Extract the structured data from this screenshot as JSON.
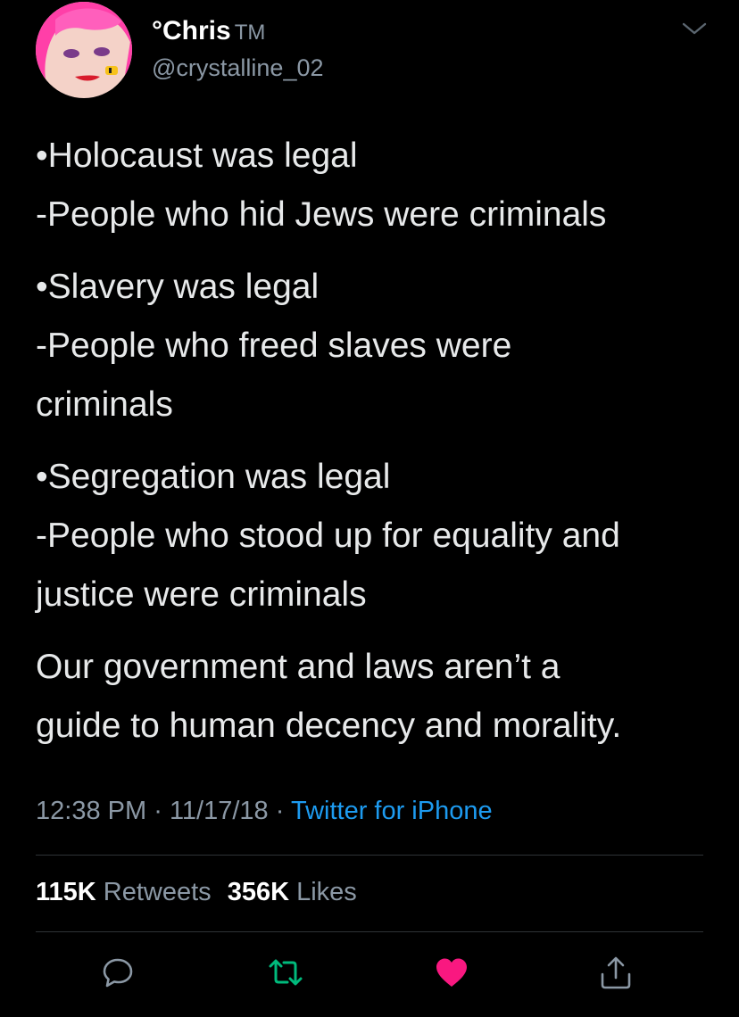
{
  "author": {
    "display_name": "°Chris",
    "badge": "TM",
    "handle": "@crystalline_02"
  },
  "icons": {
    "menu": "chevron-down-icon",
    "reply": "reply-icon",
    "retweet": "retweet-icon",
    "like": "heart-icon",
    "share": "share-icon"
  },
  "tweet": {
    "paragraphs": [
      [
        "•Holocaust was legal",
        "-People who hid Jews were criminals"
      ],
      [
        "•Slavery was legal",
        "-People who freed slaves were",
        "criminals"
      ],
      [
        "•Segregation was legal",
        "-People who stood up for equality and",
        "justice were criminals"
      ],
      [
        "Our government and laws aren’t a",
        "guide to human decency and morality."
      ]
    ]
  },
  "meta": {
    "time": "12:38 PM",
    "date": "11/17/18",
    "separator": "·",
    "source": "Twitter for iPhone"
  },
  "stats": {
    "retweets_count": "115K",
    "retweets_label": "Retweets",
    "likes_count": "356K",
    "likes_label": "Likes"
  },
  "colors": {
    "background": "#000000",
    "text": "#e7e9ea",
    "secondary": "#8b98a5",
    "link": "#1d9bf0",
    "retweet_active": "#00ba7c",
    "like_active": "#f91880",
    "divider": "#2f3336"
  }
}
